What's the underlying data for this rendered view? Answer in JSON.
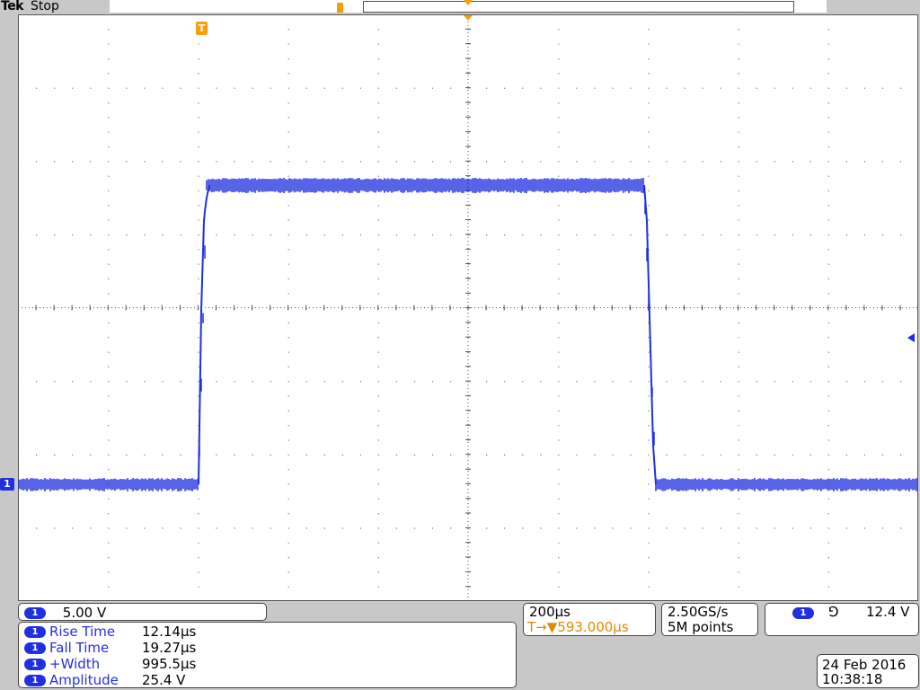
{
  "header": {
    "brand": "Tek",
    "acq_state": "Stop"
  },
  "markers": {
    "trigger_glyph": "T",
    "channel_glyph": "1"
  },
  "channel": {
    "scale": "5.00 V"
  },
  "timebase": {
    "scale": "200µs",
    "trigger_delay": "593.000µs",
    "delay_prefix": "T→▼"
  },
  "acquisition": {
    "sample_rate": "2.50GS/s",
    "record_length": "5M points"
  },
  "trigger": {
    "slope_glyph": "⅁",
    "level": "12.4 V"
  },
  "measurements": [
    {
      "label": "Rise Time",
      "value": "12.14µs"
    },
    {
      "label": "Fall Time",
      "value": "19.27µs"
    },
    {
      "label": "+Width",
      "value": "995.5µs"
    },
    {
      "label": "Amplitude",
      "value": "25.4 V"
    }
  ],
  "datetime": {
    "date": "24 Feb  2016",
    "time": "10:38:18"
  },
  "colors": {
    "trace": "#2030e0",
    "trigger": "#f5a00a",
    "graticule": "#555555"
  }
}
